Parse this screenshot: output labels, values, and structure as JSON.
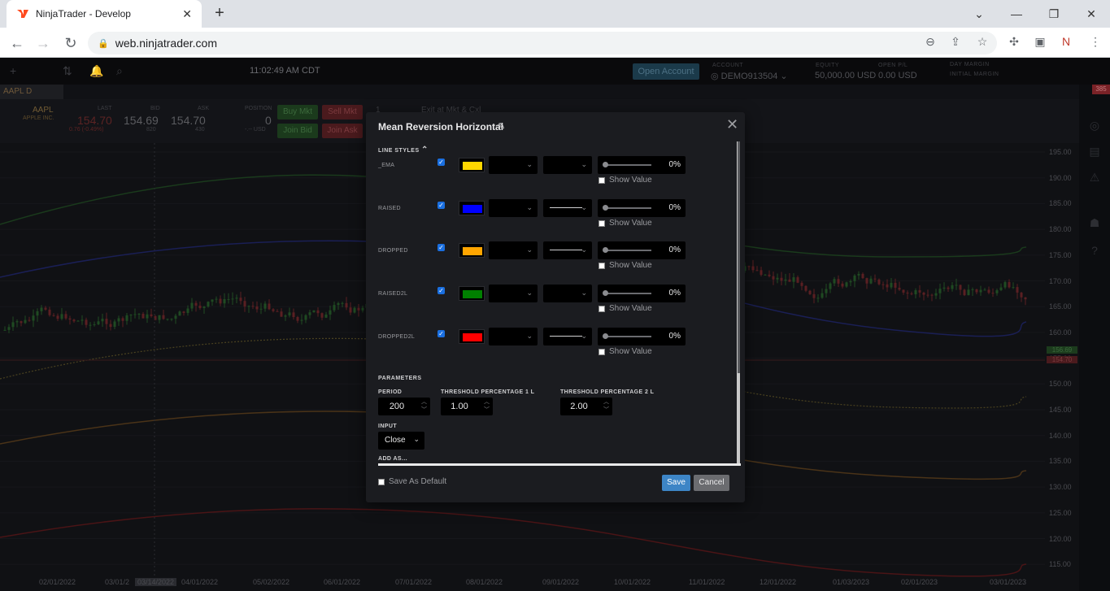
{
  "browser": {
    "tab_title": "NinjaTrader - Develop",
    "url": "web.ninjatrader.com"
  },
  "app": {
    "clock": "11:02:49 AM CDT",
    "open_account": "Open Account",
    "account_label": "ACCOUNT",
    "account": "DEMO913504",
    "equity_label": "EQUITY",
    "equity": "50,000.00 USD",
    "open_pl_label": "OPEN P/L",
    "open_pl": "0.00 USD",
    "day_margin_label": "DAY MARGIN",
    "initial_margin_label": "INITIAL MARGIN",
    "badge": "385"
  },
  "instrument_tab": "AAPL D",
  "quote": {
    "symbol": "AAPL",
    "company": "APPLE INC.",
    "last_label": "LAST",
    "last": "154.70",
    "change": "0.76 (-0.49%)",
    "bid_label": "BID",
    "bid": "154.69",
    "bid_size": "820",
    "ask_label": "ASK",
    "ask": "154.70",
    "ask_size": "430",
    "position_label": "POSITION",
    "position": "0",
    "position_usd": "-.-- USD",
    "buy_mkt": "Buy Mkt",
    "sell_mkt": "Sell Mkt",
    "join_bid": "Join Bid",
    "join_ask": "Join Ask",
    "qty": "1",
    "exit_label": "Exit at Mkt & Cxl"
  },
  "chart_axis": {
    "y_ticks": [
      "195.00",
      "190.00",
      "185.00",
      "180.00",
      "175.00",
      "170.00",
      "165.00",
      "160.00",
      "155.00",
      "150.00",
      "145.00",
      "140.00",
      "135.00",
      "130.00",
      "125.00",
      "120.00",
      "115.00"
    ],
    "x_ticks": [
      "02/01/2022",
      "03/01/2",
      "03/14/2022",
      "04/01/2022",
      "05/02/2022",
      "06/01/2022",
      "07/01/2022",
      "08/01/2022",
      "09/01/2022",
      "10/01/2022",
      "11/01/2022",
      "12/01/2022",
      "01/03/2023",
      "02/01/2023",
      "03/01/2023"
    ],
    "price_tag_1": "156.69",
    "price_tag_2": "154.70"
  },
  "dialog": {
    "title": "Mean Reversion Horizontal",
    "line_styles_label": "LINE STYLES",
    "show_value_label": "Show Value",
    "lines": [
      {
        "name": "_EMA",
        "color": "#ffd700",
        "dashed": false,
        "opacity": "0%"
      },
      {
        "name": "RAISED",
        "color": "#0000ff",
        "dashed": true,
        "opacity": "0%"
      },
      {
        "name": "DROPPED",
        "color": "#ffa500",
        "dashed": true,
        "opacity": "0%"
      },
      {
        "name": "RAISED2L",
        "color": "#008000",
        "dashed": false,
        "opacity": "0%"
      },
      {
        "name": "DROPPED2L",
        "color": "#ff0000",
        "dashed": true,
        "opacity": "0%"
      }
    ],
    "parameters_label": "PARAMETERS",
    "period_label": "PERIOD",
    "period": "200",
    "thr1_label": "THRESHOLD PERCENTAGE 1 L",
    "thr1": "1.00",
    "thr2_label": "THRESHOLD PERCENTAGE 2 L",
    "thr2": "2.00",
    "input_label": "INPUT",
    "input_value": "Close",
    "add_as_label": "ADD AS...",
    "save_as_default": "Save As Default",
    "save": "Save",
    "cancel": "Cancel"
  }
}
